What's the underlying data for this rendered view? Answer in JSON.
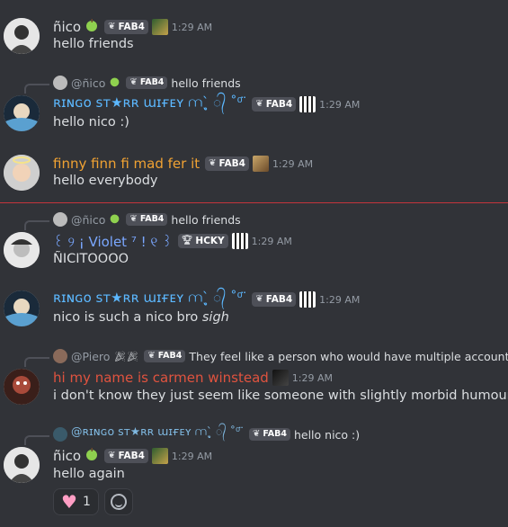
{
  "messages": [
    {
      "author": "ñico",
      "author_color": "#dbdee1",
      "badge": "FAB4",
      "time": "1:29 AM",
      "text": "hello friends"
    },
    {
      "reply": {
        "author": "@ñico",
        "badge": "FAB4",
        "text": "hello friends"
      },
      "author": "ʀɪɴɢᴏ sᴛ★ʀʀ ɯɪғᴇʏ ⩋ˎ̥̀ ᭄ ˚⁰ ̈",
      "author_color": "#5cb8ff",
      "badge": "FAB4",
      "time": "1:29 AM",
      "text": "hello nico :)"
    },
    {
      "author": "finny finn fi mad fer it",
      "author_color": "#f0a233",
      "badge": "FAB4",
      "time": "1:29 AM",
      "text": "hello everybody"
    },
    {
      "reply": {
        "author": "@ñico",
        "badge": "FAB4",
        "text": "hello friends"
      },
      "author": "꒰ ୨ ¡ Violet ⁷ ! ୧ ꒱",
      "author_color": "#7aa7ff",
      "badge": "HCKY",
      "time": "1:29 AM",
      "text": "ÑICITOOOO"
    },
    {
      "author": "ʀɪɴɢᴏ sᴛ★ʀʀ ɯɪғᴇʏ ⩋ˎ̥̀ ᭄ ˚⁰ ̈",
      "author_color": "#5cb8ff",
      "badge": "FAB4",
      "time": "1:29 AM",
      "text_plain": "nico is such a nico bro ",
      "text_italic": "sigh"
    },
    {
      "reply": {
        "author": "@Piero",
        "badge": "FAB4",
        "text": "They feel like a person who would have multiple accounts"
      },
      "author": "hi my name is carmen winstead",
      "author_color": "#e0533f",
      "time": "1:29 AM",
      "text": "i don't know they just seem like someone with slightly morbid humour"
    },
    {
      "reply": {
        "author": "@ʀɪɴɢᴏ sᴛ★ʀʀ ɯɪғᴇʏ ⩋ˎ̥̀ ᭄ ˚⁰ ̈",
        "badge": "FAB4",
        "text": "hello nico :)"
      },
      "author": "ñico",
      "author_color": "#dbdee1",
      "badge": "FAB4",
      "time": "1:29 AM",
      "text": "hello again"
    }
  ],
  "reactions": [
    {
      "emoji": "heart",
      "count": "1"
    }
  ],
  "icons": {
    "apple": "green-apple-icon",
    "badge_leaf": "leaf-icon",
    "badge_trophy": "trophy-icon",
    "add_reaction": "add-reaction-icon"
  },
  "colors": {
    "background": "#313338",
    "new_messages_divider": "#c4353c"
  }
}
